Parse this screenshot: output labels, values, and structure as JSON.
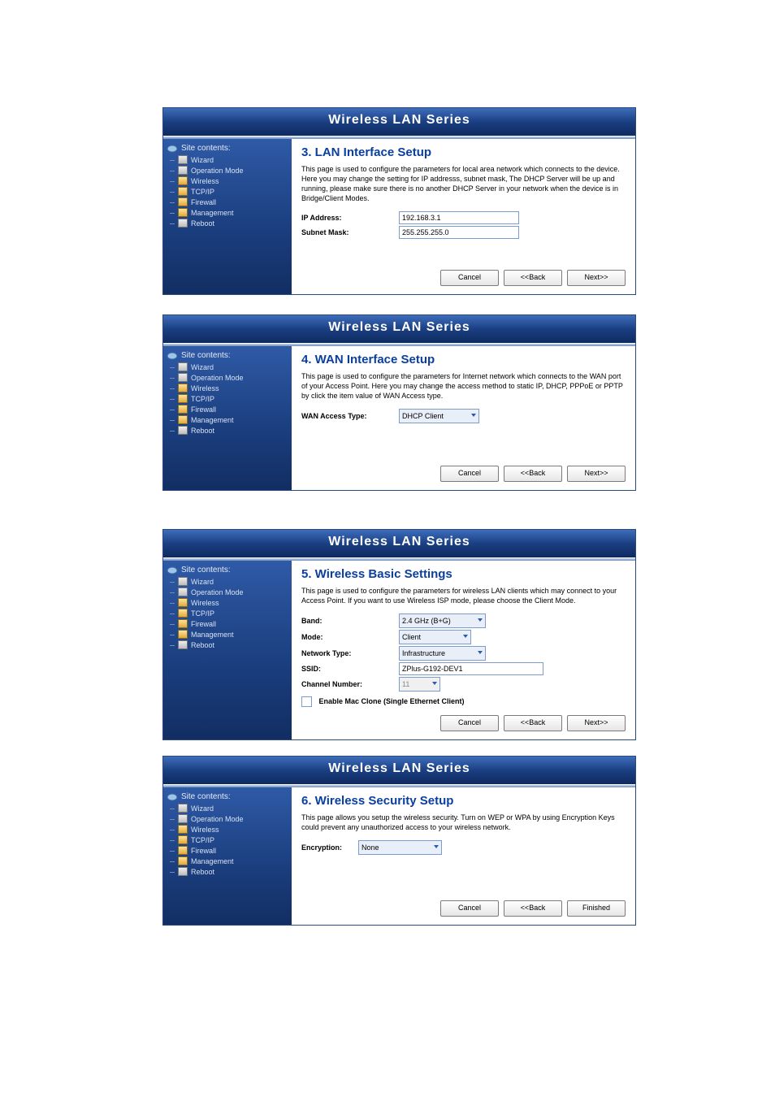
{
  "header_title": "Wireless LAN Series",
  "sidebar": {
    "header": "Site contents:",
    "items": [
      {
        "label": "Wizard",
        "icon": "doc"
      },
      {
        "label": "Operation Mode",
        "icon": "doc"
      },
      {
        "label": "Wireless",
        "icon": "fldr"
      },
      {
        "label": "TCP/IP",
        "icon": "fldr"
      },
      {
        "label": "Firewall",
        "icon": "fldr"
      },
      {
        "label": "Management",
        "icon": "fldr"
      },
      {
        "label": "Reboot",
        "icon": "doc"
      }
    ]
  },
  "buttons": {
    "cancel": "Cancel",
    "back": "<<Back",
    "next": "Next>>",
    "finish": "Finished"
  },
  "panels": [
    {
      "id": "lan",
      "title": "3. LAN Interface Setup",
      "description": "This page is used to configure the parameters for local area network which connects to the device. Here you may change the setting for IP addresss, subnet mask, The DHCP Server will be up and running, please make sure there is no another DHCP Server in your network when the device is in Bridge/Client Modes.",
      "fields": {
        "ip_label": "IP Address:",
        "ip_value": "192.168.3.1",
        "mask_label": "Subnet Mask:",
        "mask_value": "255.255.255.0"
      },
      "buttons": [
        "cancel",
        "back",
        "next"
      ]
    },
    {
      "id": "wan",
      "title": "4. WAN Interface Setup",
      "description": "This page is used to configure the parameters for Internet network which connects to the WAN port of your Access Point. Here you may change the access method to static IP, DHCP, PPPoE or PPTP by click the item value of WAN Access type.",
      "fields": {
        "wan_label": "WAN Access Type:",
        "wan_value": "DHCP Client"
      },
      "buttons": [
        "cancel",
        "back",
        "next"
      ]
    },
    {
      "id": "wifi",
      "title": "5. Wireless Basic Settings",
      "description": "This page is used to configure the parameters for wireless LAN clients which may connect to your Access Point. If you want to use Wireless ISP mode, please choose the Client Mode.",
      "fields": {
        "band_label": "Band:",
        "band_value": "2.4 GHz (B+G)",
        "mode_label": "Mode:",
        "mode_value": "Client",
        "nettype_label": "Network Type:",
        "nettype_value": "Infrastructure",
        "ssid_label": "SSID:",
        "ssid_value": "ZPlus-G192-DEV1",
        "chan_label": "Channel Number:",
        "chan_value": "11",
        "mac_clone_label": "Enable Mac Clone (Single Ethernet Client)"
      },
      "buttons": [
        "cancel",
        "back",
        "next"
      ]
    },
    {
      "id": "sec",
      "title": "6. Wireless Security Setup",
      "description": "This page allows you setup the wireless security. Turn on WEP or WPA by using Encryption Keys could prevent any unauthorized access to your wireless network.",
      "fields": {
        "enc_label": "Encryption:",
        "enc_value": "None"
      },
      "buttons": [
        "cancel",
        "back",
        "finish"
      ]
    }
  ],
  "panel_positions": {
    "lan": 132,
    "wan": 387,
    "wifi": 651,
    "sec": 930
  }
}
